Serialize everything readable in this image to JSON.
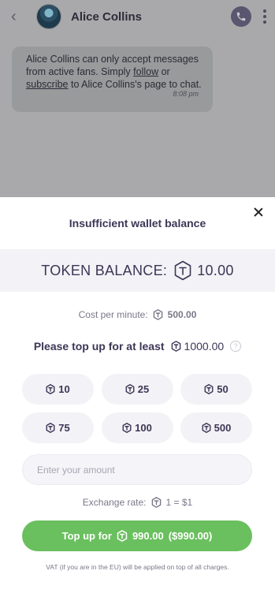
{
  "chat": {
    "back_icon": "chevron-left-icon",
    "contact_name": "Alice Collins",
    "call_icon": "phone-icon",
    "more_icon": "kebab-icon",
    "message": {
      "text_before_follow": "Alice Collins can only accept messages from active fans. Simply ",
      "follow_link": "follow",
      "text_or": " or ",
      "subscribe_link": "subscribe",
      "text_after": " to Alice Collins's page to chat.",
      "time": "8:08 pm"
    }
  },
  "modal": {
    "title": "Insufficient wallet balance",
    "close_icon": "close-icon",
    "balance_label": "TOKEN BALANCE:",
    "balance_value": "10.00",
    "cost_label": "Cost per minute:",
    "cost_value": "500.00",
    "topup_label": "Please top up for at least",
    "topup_min": "1000.00",
    "help_icon": "?",
    "options": [
      "10",
      "25",
      "50",
      "75",
      "100",
      "500"
    ],
    "amount_placeholder": "Enter your amount",
    "rate_label": "Exchange rate:",
    "rate_value": "1 = $1",
    "cta_prefix": "Top up for",
    "cta_amount": "990.00",
    "cta_usd": "($990.00)",
    "vat_note": "VAT (if you are in the EU) will be applied on top of all charges."
  },
  "colors": {
    "accent_green": "#6abf5e",
    "text_dark": "#3d3656",
    "muted": "#7b7788",
    "overlay_gray": "#a9a9ab"
  }
}
